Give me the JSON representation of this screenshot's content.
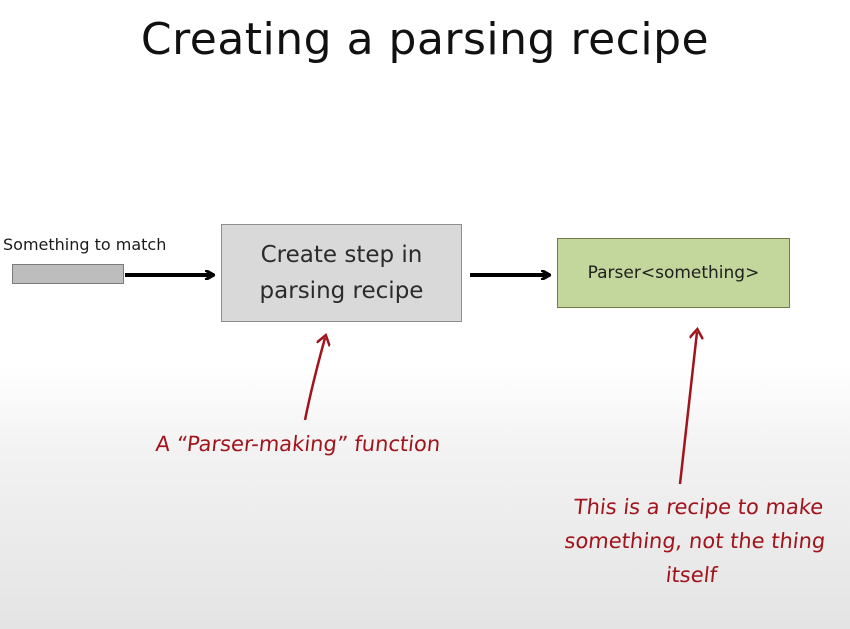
{
  "title": "Creating a parsing recipe",
  "input_label": "Something to match",
  "step_box": {
    "line1": "Create step in",
    "line2": "parsing recipe"
  },
  "result_box": "Parser<something>",
  "annotations": {
    "parser_making": "A “Parser-making” function",
    "recipe_note_1": "This is a recipe to make",
    "recipe_note_2": "something, not the thing",
    "recipe_note_3": "itself"
  },
  "colors": {
    "step_box_fill": "#d9d9d9",
    "result_box_fill": "#c3d69b",
    "annotation": "#a0141c"
  }
}
